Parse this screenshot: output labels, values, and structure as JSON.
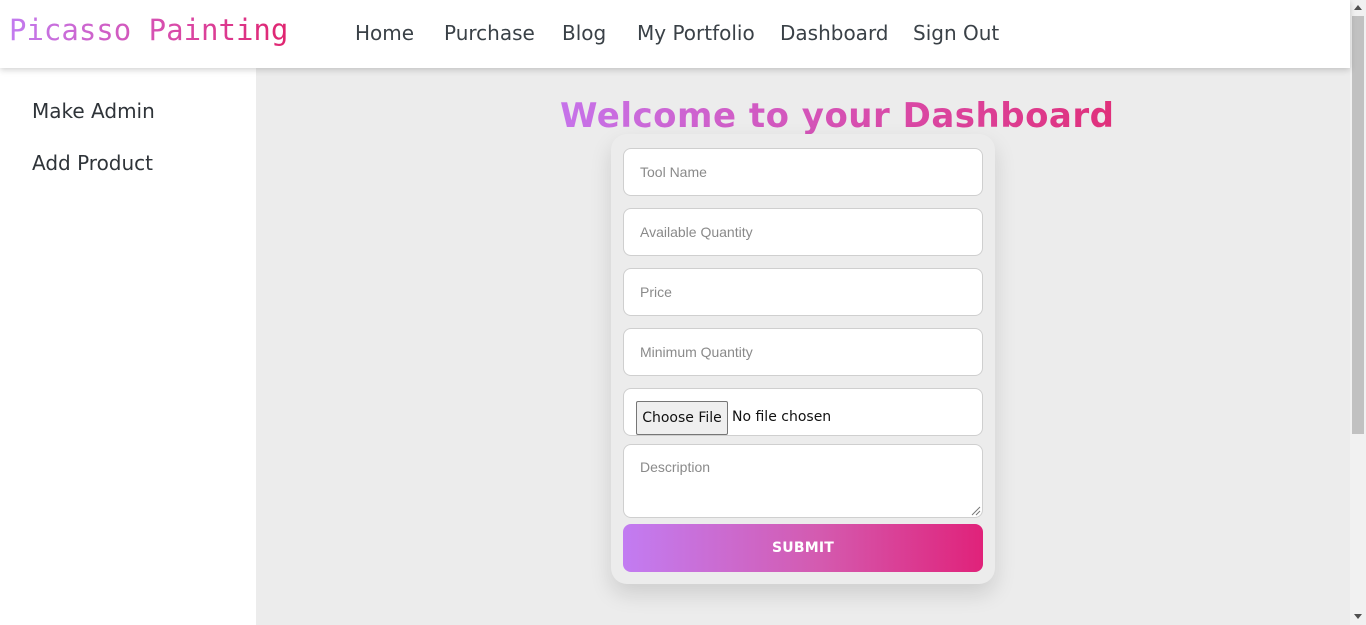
{
  "brand": {
    "title": "Picasso Painting"
  },
  "nav": {
    "home": "Home",
    "purchase": "Purchase",
    "blog": "Blog",
    "portfolio": "My Portfolio",
    "dashboard": "Dashboard",
    "signout": "Sign Out"
  },
  "sidebar": {
    "items": [
      {
        "label": "Make Admin"
      },
      {
        "label": "Add Product"
      }
    ]
  },
  "main": {
    "heading": "Welcome to your Dashboard"
  },
  "form": {
    "tool_name": {
      "placeholder": "Tool Name",
      "value": ""
    },
    "available_quantity": {
      "placeholder": "Available Quantity",
      "value": ""
    },
    "price": {
      "placeholder": "Price",
      "value": ""
    },
    "minimum_quantity": {
      "placeholder": "Minimum Quantity",
      "value": ""
    },
    "file": {
      "button_label": "Choose File",
      "status": "No file chosen"
    },
    "description": {
      "placeholder": "Description",
      "value": ""
    },
    "submit_label": "SUBMIT"
  },
  "colors": {
    "gradient_start": "#c27cf2",
    "gradient_end": "#e0227a",
    "background": "#ececec"
  }
}
